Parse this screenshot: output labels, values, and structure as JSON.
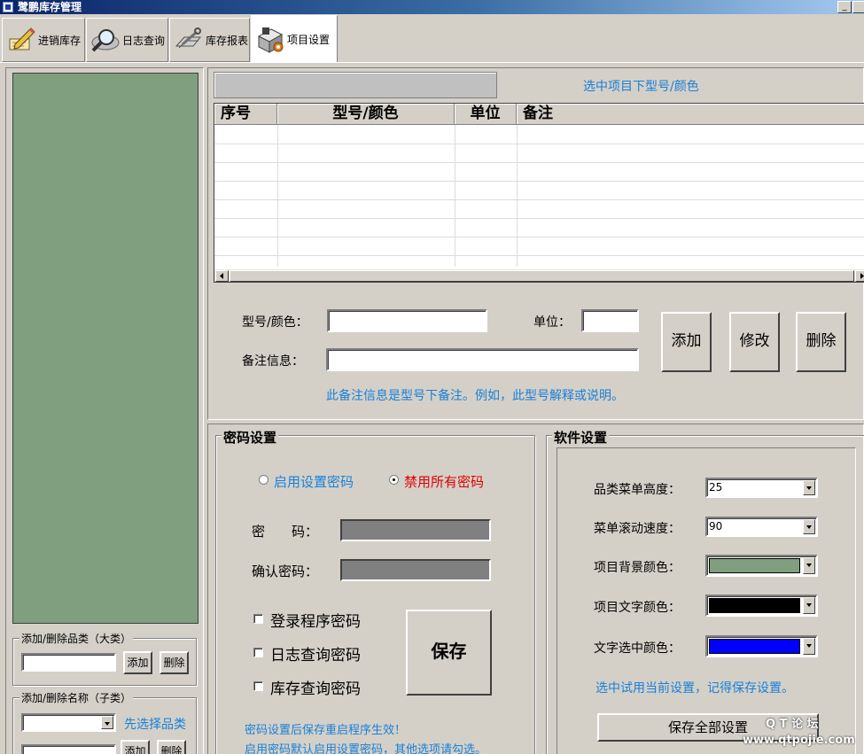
{
  "window": {
    "title": "鹭鹏库存管理"
  },
  "tabs": [
    {
      "label": "进销库存",
      "icon": "pencil-notes-icon"
    },
    {
      "label": "日志查询",
      "icon": "magnifier-icon"
    },
    {
      "label": "库存报表",
      "icon": "wrench-report-icon"
    },
    {
      "label": "项目设置",
      "icon": "settings-box-icon",
      "active": true
    }
  ],
  "colors": {
    "tree_bg": "#7f9f7f",
    "blue_text": "#1a80d8",
    "red_text": "#e00000",
    "selection": "#0000ff"
  },
  "left": {
    "category_group": {
      "title": "添加/删除品类（大类）",
      "input": "",
      "add": "添加",
      "delete": "删除"
    },
    "name_group": {
      "title": "添加/删除名称（子类）",
      "select": "",
      "hint": "先选择品类",
      "input": "",
      "add": "添加",
      "delete": "删除"
    }
  },
  "models": {
    "hint": "选中项目下型号/颜色",
    "columns": [
      "序号",
      "型号/颜色",
      "单位",
      "备注"
    ],
    "rows": [],
    "form": {
      "model_label": "型号/颜色：",
      "model_value": "",
      "unit_label": "单位：",
      "unit_value": "",
      "note_label": "备注信息：",
      "note_value": "",
      "add": "添加",
      "edit": "修改",
      "delete": "删除",
      "note_hint": "此备注信息是型号下备注。例如，此型号解释或说明。"
    }
  },
  "password": {
    "title": "密码设置",
    "radio_enable": "启用设置密码",
    "radio_disable": "禁用所有密码",
    "selected": "禁用所有密码",
    "pwd_label": "密　　码：",
    "confirm_label": "确认密码：",
    "chk_login": "登录程序密码",
    "chk_log": "日志查询密码",
    "chk_stock": "库存查询密码",
    "save": "保存",
    "note1": "密码设置后保存重启程序生效！",
    "note2": "启用密码默认启用设置密码，其他选项请勾选。"
  },
  "software": {
    "title": "软件设置",
    "menu_height_label": "品类菜单高度：",
    "menu_height_value": "25",
    "scroll_speed_label": "菜单滚动速度：",
    "scroll_speed_value": "90",
    "bg_color_label": "项目背景颜色：",
    "bg_color": "#7f9f7f",
    "text_color_label": "项目文字颜色：",
    "text_color": "#000000",
    "sel_color_label": "文字选中颜色：",
    "sel_color": "#0000ff",
    "hint": "选中试用当前设置，记得保存设置。",
    "save_all": "保存全部设置"
  },
  "watermark": {
    "line1": "Q T 论 坛",
    "line2": "www.qtpojie.com"
  }
}
